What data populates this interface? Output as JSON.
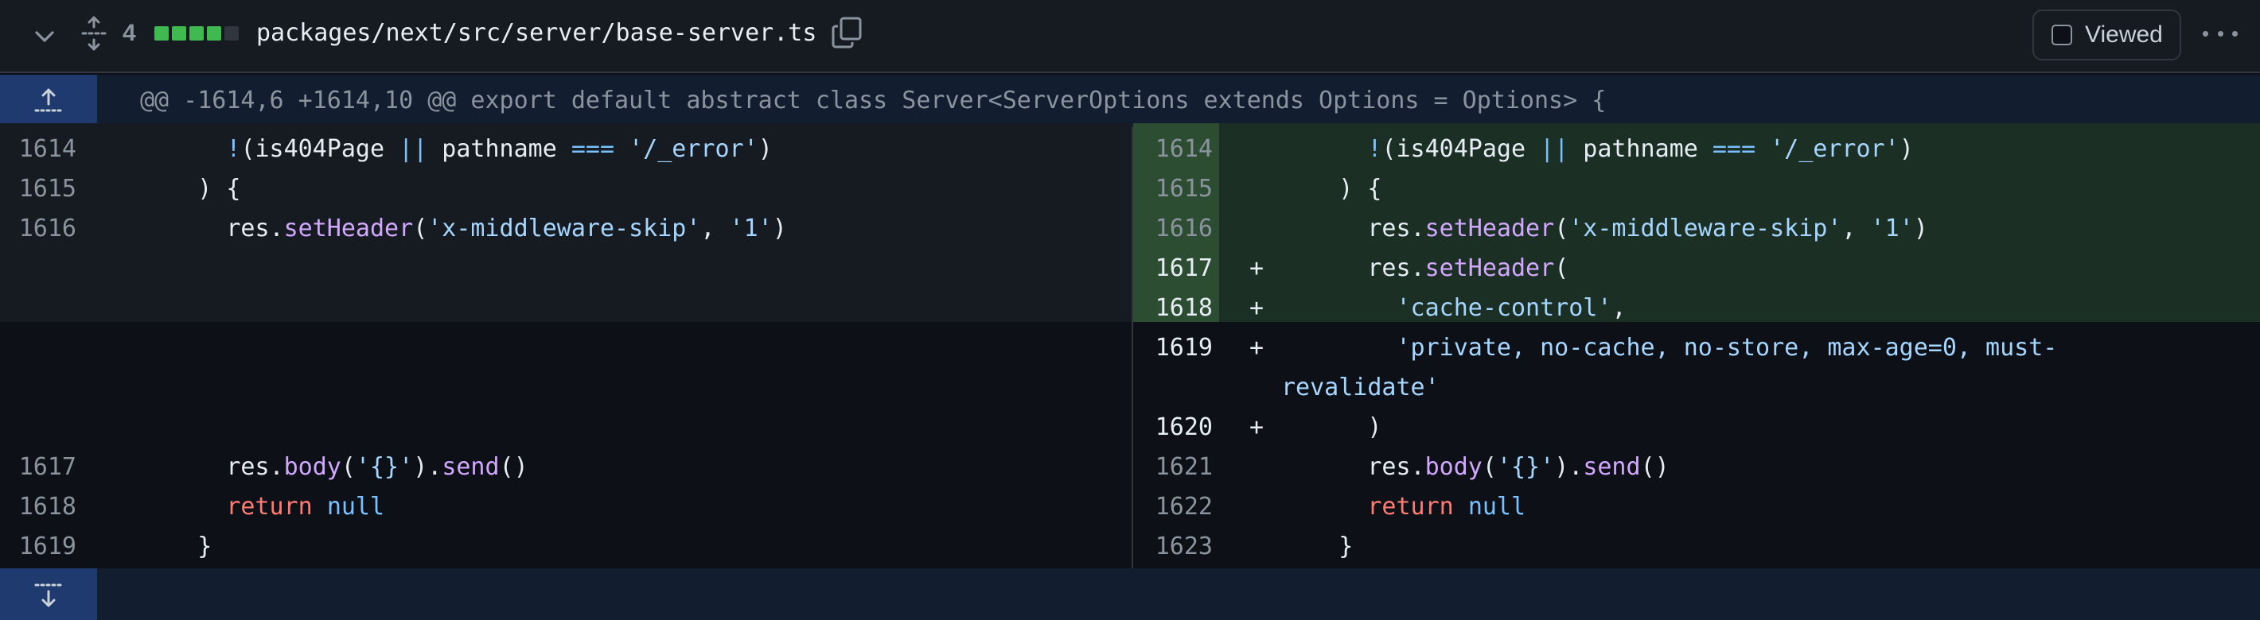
{
  "file": {
    "changes_count": "4",
    "path": "packages/next/src/server/base-server.ts",
    "viewed_label": "Viewed",
    "diffstat": [
      "#3fb950",
      "#3fb950",
      "#3fb950",
      "#3fb950",
      "#30363d"
    ]
  },
  "hunk": {
    "header": "@@ -1614,6 +1614,10 @@ export default abstract class Server<ServerOptions extends Options = Options> {"
  },
  "left_lines": [
    {
      "num": "1614",
      "segments": [
        {
          "t": "      ",
          "c": ""
        },
        {
          "t": "!",
          "c": "t-op"
        },
        {
          "t": "(is404Page ",
          "c": ""
        },
        {
          "t": "||",
          "c": "t-op"
        },
        {
          "t": " pathname ",
          "c": ""
        },
        {
          "t": "===",
          "c": "t-op"
        },
        {
          "t": " ",
          "c": ""
        },
        {
          "t": "'/_error'",
          "c": "t-str"
        },
        {
          "t": ")",
          "c": ""
        }
      ]
    },
    {
      "num": "1615",
      "segments": [
        {
          "t": "    ) {",
          "c": ""
        }
      ]
    },
    {
      "num": "1616",
      "segments": [
        {
          "t": "      res.",
          "c": ""
        },
        {
          "t": "setHeader",
          "c": "t-fn"
        },
        {
          "t": "(",
          "c": ""
        },
        {
          "t": "'x-middleware-skip'",
          "c": "t-str"
        },
        {
          "t": ", ",
          "c": ""
        },
        {
          "t": "'1'",
          "c": "t-str"
        },
        {
          "t": ")",
          "c": ""
        }
      ]
    },
    {
      "num": "1617",
      "segments": [
        {
          "t": "      res.",
          "c": ""
        },
        {
          "t": "body",
          "c": "t-fn"
        },
        {
          "t": "(",
          "c": ""
        },
        {
          "t": "'{}'",
          "c": "t-str"
        },
        {
          "t": ").",
          "c": ""
        },
        {
          "t": "send",
          "c": "t-fn"
        },
        {
          "t": "()",
          "c": ""
        }
      ]
    },
    {
      "num": "1618",
      "segments": [
        {
          "t": "      ",
          "c": ""
        },
        {
          "t": "return",
          "c": "t-kw"
        },
        {
          "t": " ",
          "c": ""
        },
        {
          "t": "null",
          "c": "t-const"
        }
      ]
    },
    {
      "num": "1619",
      "segments": [
        {
          "t": "    }",
          "c": ""
        }
      ]
    }
  ],
  "right_lines": [
    {
      "num": "1614",
      "marker": "",
      "segments": [
        {
          "t": "      ",
          "c": ""
        },
        {
          "t": "!",
          "c": "t-op"
        },
        {
          "t": "(is404Page ",
          "c": ""
        },
        {
          "t": "||",
          "c": "t-op"
        },
        {
          "t": " pathname ",
          "c": ""
        },
        {
          "t": "===",
          "c": "t-op"
        },
        {
          "t": " ",
          "c": ""
        },
        {
          "t": "'/_error'",
          "c": "t-str"
        },
        {
          "t": ")",
          "c": ""
        }
      ]
    },
    {
      "num": "1615",
      "marker": "",
      "segments": [
        {
          "t": "    ) {",
          "c": ""
        }
      ]
    },
    {
      "num": "1616",
      "marker": "",
      "segments": [
        {
          "t": "      res.",
          "c": ""
        },
        {
          "t": "setHeader",
          "c": "t-fn"
        },
        {
          "t": "(",
          "c": ""
        },
        {
          "t": "'x-middleware-skip'",
          "c": "t-str"
        },
        {
          "t": ", ",
          "c": ""
        },
        {
          "t": "'1'",
          "c": "t-str"
        },
        {
          "t": ")",
          "c": ""
        }
      ]
    },
    {
      "num": "1617",
      "marker": "+",
      "segments": [
        {
          "t": "      res.",
          "c": ""
        },
        {
          "t": "setHeader",
          "c": "t-fn"
        },
        {
          "t": "(",
          "c": ""
        }
      ]
    },
    {
      "num": "1618",
      "marker": "+",
      "segments": [
        {
          "t": "        ",
          "c": ""
        },
        {
          "t": "'cache-control'",
          "c": "t-str"
        },
        {
          "t": ",",
          "c": ""
        }
      ]
    },
    {
      "num": "1619",
      "marker": "+",
      "segments": [
        {
          "t": "        ",
          "c": ""
        },
        {
          "t": "'private, no-cache, no-store, max-age=0, must-",
          "c": "t-str"
        }
      ]
    },
    {
      "num": "",
      "marker": "",
      "segments": [
        {
          "t": "revalidate'",
          "c": "t-str"
        }
      ]
    },
    {
      "num": "1620",
      "marker": "+",
      "segments": [
        {
          "t": "      )",
          "c": ""
        }
      ]
    },
    {
      "num": "1621",
      "marker": "",
      "segments": [
        {
          "t": "      res.",
          "c": ""
        },
        {
          "t": "body",
          "c": "t-fn"
        },
        {
          "t": "(",
          "c": ""
        },
        {
          "t": "'{}'",
          "c": "t-str"
        },
        {
          "t": ").",
          "c": ""
        },
        {
          "t": "send",
          "c": "t-fn"
        },
        {
          "t": "()",
          "c": ""
        }
      ]
    },
    {
      "num": "1622",
      "marker": "",
      "segments": [
        {
          "t": "      ",
          "c": ""
        },
        {
          "t": "return",
          "c": "t-kw"
        },
        {
          "t": " ",
          "c": ""
        },
        {
          "t": "null",
          "c": "t-const"
        }
      ]
    },
    {
      "num": "1623",
      "marker": "",
      "segments": [
        {
          "t": "    }",
          "c": ""
        }
      ]
    }
  ],
  "icons": {
    "collapse": "chevron-down-icon",
    "expand_all": "unfold-icon",
    "copy": "copy-icon",
    "kebab": "kebab-horizontal-icon",
    "expand_up": "expand-up-icon",
    "expand_down": "expand-down-icon"
  }
}
